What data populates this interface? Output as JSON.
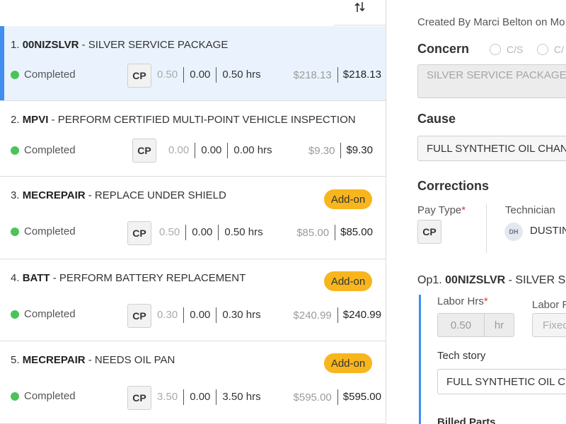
{
  "operations": [
    {
      "index": "1.",
      "code": "00NIZSLVR",
      "description": "- SILVER SERVICE PACKAGE",
      "status": "Completed",
      "pay_type": "CP",
      "hrs_sold": "0.50",
      "hrs_actual": "0.00",
      "hrs_total": "0.50 hrs",
      "price": "$218.13",
      "total": "$218.13",
      "addon": "",
      "selected": true
    },
    {
      "index": "2.",
      "code": "MPVI",
      "description": "- PERFORM CERTIFIED MULTI-POINT VEHICLE INSPECTION",
      "status": "Completed",
      "pay_type": "CP",
      "hrs_sold": "0.00",
      "hrs_actual": "0.00",
      "hrs_total": "0.00 hrs",
      "price": "$9.30",
      "total": "$9.30",
      "addon": "",
      "selected": false
    },
    {
      "index": "3.",
      "code": "MECREPAIR",
      "description": "- REPLACE UNDER SHIELD",
      "status": "Completed",
      "pay_type": "CP",
      "hrs_sold": "0.50",
      "hrs_actual": "0.00",
      "hrs_total": "0.50 hrs",
      "price": "$85.00",
      "total": "$85.00",
      "addon": "Add-on",
      "selected": false
    },
    {
      "index": "4.",
      "code": "BATT",
      "description": "- PERFORM BATTERY REPLACEMENT",
      "status": "Completed",
      "pay_type": "CP",
      "hrs_sold": "0.30",
      "hrs_actual": "0.00",
      "hrs_total": "0.30 hrs",
      "price": "$240.99",
      "total": "$240.99",
      "addon": "Add-on",
      "selected": false
    },
    {
      "index": "5.",
      "code": "MECREPAIR",
      "description": "- NEEDS OIL PAN",
      "status": "Completed",
      "pay_type": "CP",
      "hrs_sold": "3.50",
      "hrs_actual": "0.00",
      "hrs_total": "3.50 hrs",
      "price": "$595.00",
      "total": "$595.00",
      "addon": "Add-on",
      "selected": false
    }
  ],
  "detail": {
    "created_by": "Created By Marci Belton on Mo",
    "concern_label": "Concern",
    "radio_1": "C/S",
    "radio_2": "C/",
    "concern_text": "SILVER SERVICE PACKAGE",
    "cause_label": "Cause",
    "cause_text": "FULL SYNTHETIC OIL CHANG",
    "corrections_label": "Corrections",
    "pay_type_label": "Pay Type",
    "required_mark": "*",
    "pay_type_value": "CP",
    "technician_label": "Technician",
    "tech_initials": "DH",
    "tech_name": "DUSTIN",
    "op1_prefix": "Op1.",
    "op1_code": "00NIZSLVR",
    "op1_rest": "- SILVER S",
    "labor_hrs_label": "Labor Hrs",
    "labor_hrs_value": "0.50",
    "labor_hrs_unit": "hr",
    "labor_r_label": "Labor R",
    "fixed_placeholder": "Fixed",
    "tech_story_label": "Tech story",
    "tech_story_text": "FULL SYNTHETIC OIL CH",
    "billed_parts_label": "Billed Parts"
  },
  "colors": {
    "accent": "#3f8ef0",
    "status_completed": "#4cc35a",
    "addon_badge": "#f7b51e",
    "selected_row": "#eaf3fd"
  },
  "icons": {
    "sort": "sort-arrows-icon"
  }
}
